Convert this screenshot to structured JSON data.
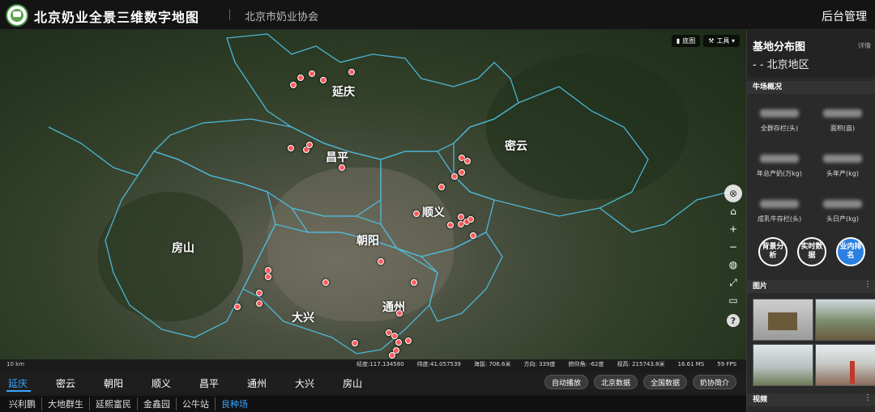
{
  "header": {
    "app_title": "北京奶业全景三维数字地图",
    "subtitle": "北京市奶业协会",
    "admin_link": "后台管理"
  },
  "map": {
    "tools": [
      {
        "icon": "book-icon",
        "label": "底图"
      },
      {
        "icon": "wrench-icon",
        "label": "工具 ▾"
      }
    ],
    "districts": [
      "延庆",
      "昌平",
      "密云",
      "顺义",
      "朝阳",
      "房山",
      "大兴",
      "通州"
    ],
    "scale_label": "10 km",
    "status": {
      "lon": "经度:117.134580",
      "lat": "纬度:41.057539",
      "height": "海拔: 706.6米",
      "heading": "方向: 339度",
      "pitch": "俯仰角: -62度",
      "view_height": "视高: 215743.8米",
      "ms": "16.61 MS",
      "fps": "59 FPS"
    }
  },
  "district_tabs": [
    "延庆",
    "密云",
    "朝阳",
    "顺义",
    "昌平",
    "通州",
    "大兴",
    "房山"
  ],
  "active_district": "延庆",
  "actions": [
    "自动播放",
    "北京数据",
    "全国数据",
    "奶协简介"
  ],
  "farms": [
    "兴利鹏",
    "大地群生",
    "延熙富民",
    "金鑫园",
    "公牛站",
    "良种场"
  ],
  "active_farm": "良种场",
  "side": {
    "title": "基地分布图",
    "subtitle": "- - 北京地区",
    "detail": "详情",
    "overview_head": "牛场概况",
    "stats": [
      "全群存栏(头)",
      "面积(亩)",
      "年总产奶(万kg)",
      "头年产(kg)",
      "成乳牛存栏(头)",
      "头日产(kg)"
    ],
    "buttons": [
      {
        "label": "背景分析",
        "active": false
      },
      {
        "label": "实时数据",
        "active": false
      },
      {
        "label": "业内排名",
        "active": true
      }
    ],
    "photos_head": "图片",
    "video_head": "视频",
    "accent": "#2b7fe0",
    "pin_color": "#ff5a5a",
    "border_color": "#4fc3e8"
  }
}
